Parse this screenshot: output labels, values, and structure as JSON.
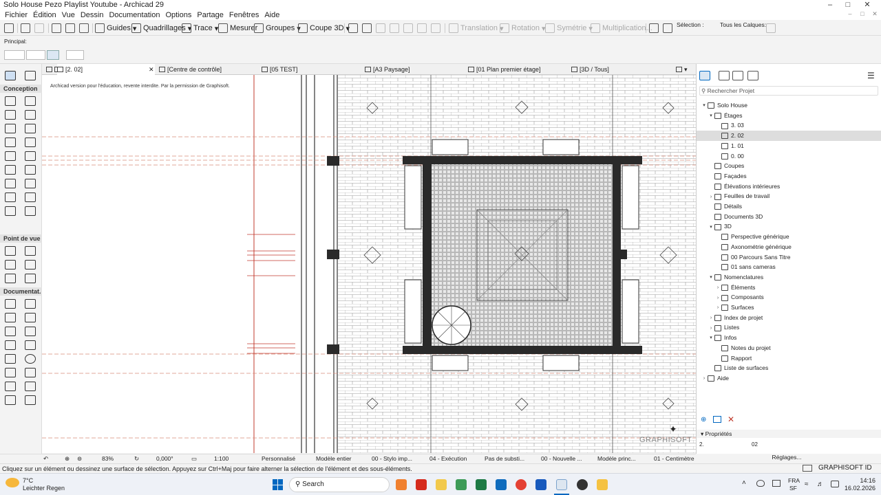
{
  "window": {
    "title": "Solo House Pezo Playlist Youtube - Archicad 29"
  },
  "menu": [
    "Fichier",
    "Édition",
    "Vue",
    "Dessin",
    "Documentation",
    "Options",
    "Partage",
    "Fenêtres",
    "Aide"
  ],
  "toolbar": {
    "guides": "Guides",
    "grids": "Quadrillages",
    "trace": "Trace",
    "measure": "Mesurer",
    "groups": "Groupes",
    "section3d": "Coupe 3D",
    "translation": "Translation",
    "rotation": "Rotation",
    "mirror": "Symétrie",
    "multiplication": "Multiplication...",
    "selection": "Sélection :",
    "all_layers": "Tous les Calques:"
  },
  "infobox": {
    "label": "Principal:"
  },
  "toolbox": {
    "design": "Conception",
    "viewpoint": "Point de vue",
    "documentation": "Documentat."
  },
  "tabs": [
    {
      "label": "[2. 02]"
    },
    {
      "label": "[Centre de contrôle]"
    },
    {
      "label": "[05 TEST]"
    },
    {
      "label": "[A3 Paysage]"
    },
    {
      "label": "[01 Plan premier étage]"
    },
    {
      "label": "[3D / Tous]"
    }
  ],
  "canvas": {
    "notice": "Archicad version pour l'éducation, revente interdite. Par la permission de Graphisoft.",
    "watermark": "GRAPHISOFT"
  },
  "status": {
    "zoom": "83%",
    "angle": "0,000°",
    "scale": "1:100",
    "custom": "Personnalisé",
    "model": "Modèle entier",
    "pen": "00 - Stylo imp...",
    "exec": "04 - Exécution",
    "sub": "Pas de substi...",
    "renov": "00 - Nouvelle ...",
    "model_view": "Modèle princ...",
    "dim": "01 - Centimètre"
  },
  "message": "Cliquez sur un élément ou dessinez une surface de sélection. Appuyez sur Ctrl+Maj pour faire alterner la sélection de l'élément et des sous-éléments.",
  "navigator": {
    "search_placeholder": "Rechercher Projet",
    "tree": [
      {
        "label": "Solo House",
        "indent": 0,
        "chev": "v"
      },
      {
        "label": "Étages",
        "indent": 1,
        "chev": "v"
      },
      {
        "label": "3. 03",
        "indent": 2,
        "chev": ""
      },
      {
        "label": "2. 02",
        "indent": 2,
        "chev": "",
        "selected": true
      },
      {
        "label": "1. 01",
        "indent": 2,
        "chev": ""
      },
      {
        "label": "0. 00",
        "indent": 2,
        "chev": ""
      },
      {
        "label": "Coupes",
        "indent": 1,
        "chev": ""
      },
      {
        "label": "Façades",
        "indent": 1,
        "chev": ""
      },
      {
        "label": "Élévations intérieures",
        "indent": 1,
        "chev": ""
      },
      {
        "label": "Feuilles de travail",
        "indent": 1,
        "chev": ">"
      },
      {
        "label": "Détails",
        "indent": 1,
        "chev": ""
      },
      {
        "label": "Documents 3D",
        "indent": 1,
        "chev": ""
      },
      {
        "label": "3D",
        "indent": 1,
        "chev": "v"
      },
      {
        "label": "Perspective générique",
        "indent": 2,
        "chev": ""
      },
      {
        "label": "Axonométrie générique",
        "indent": 2,
        "chev": ""
      },
      {
        "label": "00 Parcours Sans Titre",
        "indent": 2,
        "chev": ""
      },
      {
        "label": "01 sans cameras",
        "indent": 2,
        "chev": ""
      },
      {
        "label": "Nomenclatures",
        "indent": 1,
        "chev": "v"
      },
      {
        "label": "Éléments",
        "indent": 2,
        "chev": ">"
      },
      {
        "label": "Composants",
        "indent": 2,
        "chev": ">"
      },
      {
        "label": "Surfaces",
        "indent": 2,
        "chev": ">"
      },
      {
        "label": "Index de projet",
        "indent": 1,
        "chev": ">"
      },
      {
        "label": "Listes",
        "indent": 1,
        "chev": ">"
      },
      {
        "label": "Infos",
        "indent": 1,
        "chev": "v"
      },
      {
        "label": "Notes du projet",
        "indent": 2,
        "chev": ""
      },
      {
        "label": "Rapport",
        "indent": 2,
        "chev": ""
      },
      {
        "label": "Liste de surfaces",
        "indent": 1,
        "chev": ""
      },
      {
        "label": "Aide",
        "indent": 0,
        "chev": ">"
      }
    ],
    "properties_title": "Propriétés",
    "prop_story": "2.",
    "prop_value": "02",
    "settings_button": "Réglages...",
    "graphisoft_id": "GRAPHISOFT ID"
  },
  "taskbar": {
    "weather_temp": "7°C",
    "weather_desc": "Leichter Regen",
    "search": "Search",
    "lang": "FRA",
    "lang2": "SF",
    "time": "14:16",
    "date": "16.02.2026"
  },
  "colors": {
    "accent": "#0067c0",
    "plan_red": "#c0392b",
    "plan_dark": "#1e1e1e"
  }
}
